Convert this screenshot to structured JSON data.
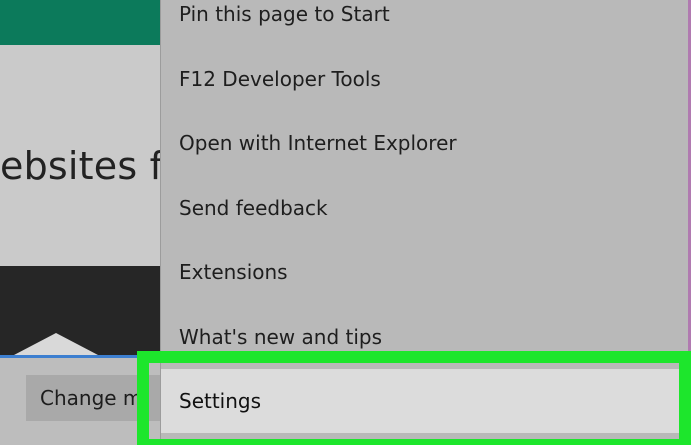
{
  "background": {
    "headline_text": "ebsites fr",
    "change_button_label": "Change m",
    "colors": {
      "header": "#0c7a5b",
      "dark_band": "#262626",
      "link_blue": "#3d7fd0"
    }
  },
  "menu": {
    "items": [
      {
        "label": "Pin this page to Start"
      },
      {
        "label": "F12 Developer Tools"
      },
      {
        "label": "Open with Internet Explorer"
      },
      {
        "label": "Send feedback"
      },
      {
        "label": "Extensions"
      },
      {
        "label": "What's new and tips"
      },
      {
        "label": "Settings",
        "highlighted": true
      }
    ]
  },
  "annotation": {
    "highlight_color": "#1de62c"
  }
}
